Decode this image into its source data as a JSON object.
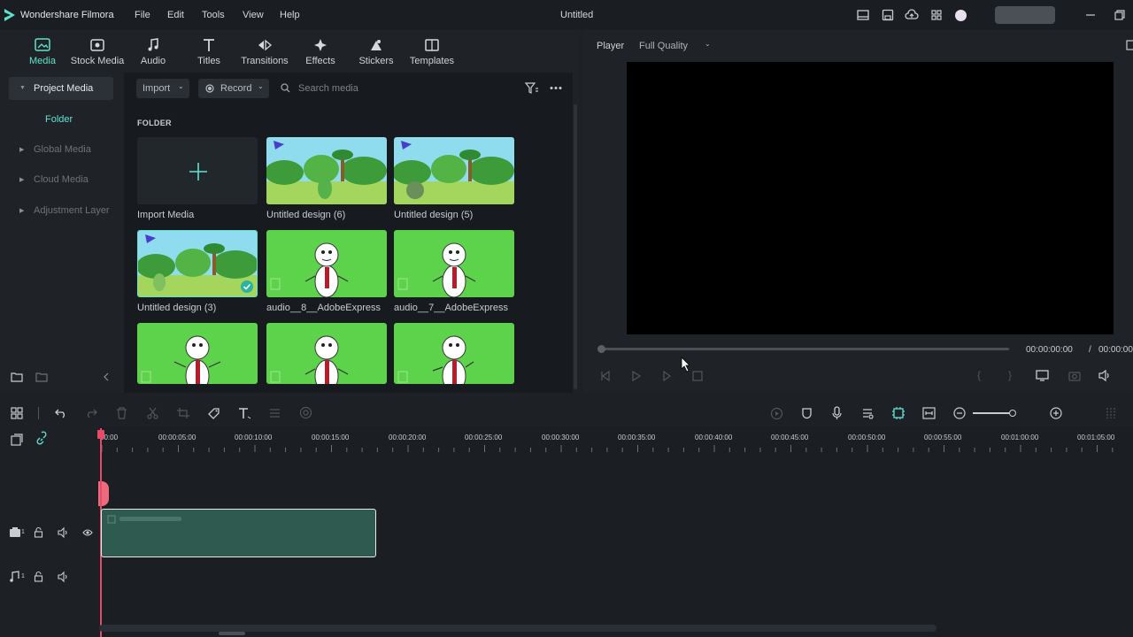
{
  "app": {
    "name": "Wondershare Filmora",
    "doc_title": "Untitled"
  },
  "menu": [
    "File",
    "Edit",
    "Tools",
    "View",
    "Help"
  ],
  "categories": [
    {
      "label": "Media",
      "icon": "media-icon",
      "active": true
    },
    {
      "label": "Stock Media",
      "icon": "stock-media-icon"
    },
    {
      "label": "Audio",
      "icon": "music-note-icon"
    },
    {
      "label": "Titles",
      "icon": "text-t-icon"
    },
    {
      "label": "Transitions",
      "icon": "transitions-icon"
    },
    {
      "label": "Effects",
      "icon": "sparkle-icon"
    },
    {
      "label": "Stickers",
      "icon": "sticker-icon"
    },
    {
      "label": "Templates",
      "icon": "templates-icon"
    }
  ],
  "sidebar": {
    "project_media": "Project Media",
    "folder": "Folder",
    "items": [
      "Global Media",
      "Cloud Media",
      "Adjustment Layer"
    ]
  },
  "media_toolbar": {
    "import": "Import",
    "record": "Record",
    "search_placeholder": "Search media"
  },
  "folder_label": "FOLDER",
  "media": {
    "import_label": "Import Media",
    "items": [
      {
        "label": "Untitled design (6)",
        "type": "jungle"
      },
      {
        "label": "Untitled design (5)",
        "type": "jungle"
      },
      {
        "label": "Untitled design (3)",
        "type": "jungle",
        "checked": true
      },
      {
        "label": "audio__8__AdobeExpress",
        "type": "snowman"
      },
      {
        "label": "audio__7__AdobeExpress",
        "type": "snowman"
      }
    ]
  },
  "player": {
    "label": "Player",
    "quality": "Full Quality",
    "time_current": "00:00:00:00",
    "time_sep": "/",
    "time_total": "00:00:00"
  },
  "ruler": [
    "00:00",
    "00:00:05:00",
    "00:00:10:00",
    "00:00:15:00",
    "00:00:20:00",
    "00:00:25:00",
    "00:00:30:00",
    "00:00:35:00",
    "00:00:40:00",
    "00:00:45:00",
    "00:00:50:00",
    "00:00:55:00",
    "00:01:00:00",
    "00:01:05:00"
  ],
  "colors": {
    "accent": "#5fe3cf",
    "playhead": "#e84a6a",
    "clip": "#2f5a4f",
    "green_screen": "#5dd34c"
  }
}
